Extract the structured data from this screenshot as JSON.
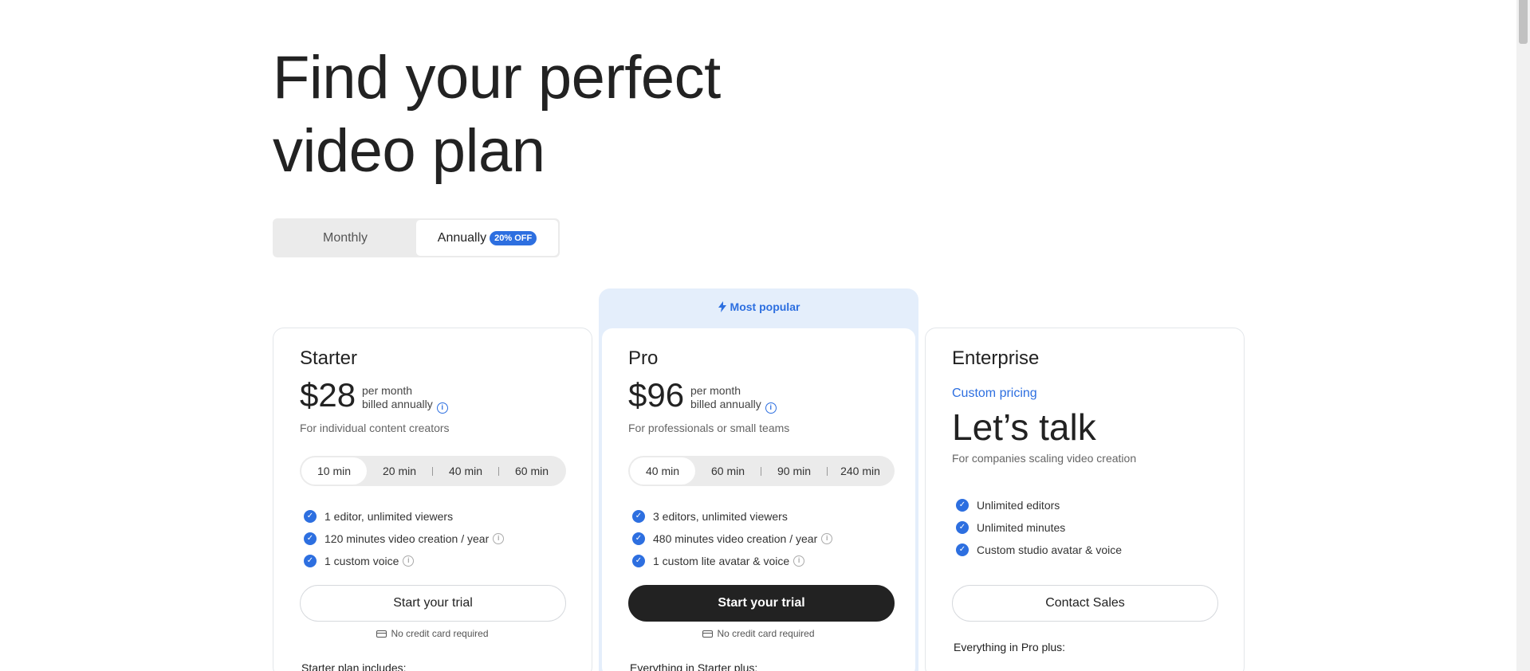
{
  "headline": {
    "line1": "Find your perfect",
    "line2": "video plan"
  },
  "billing": {
    "monthly": "Monthly",
    "annually": "Annually",
    "badge": "20% OFF",
    "selected": "annually"
  },
  "popular": {
    "label": "Most popular",
    "icon": "lightning-icon"
  },
  "colors": {
    "accent": "#2d6fe0",
    "dark_button": "#222222",
    "popular_bg": "#e4eefb"
  },
  "plans": {
    "starter": {
      "name": "Starter",
      "price": "$28",
      "per": "per month",
      "billed": "billed annually",
      "description": "For individual content creators",
      "minutes": [
        "10 min",
        "20 min",
        "40 min",
        "60 min"
      ],
      "selected_minutes": "10 min",
      "features": [
        "1 editor, unlimited viewers",
        "120 minutes video creation / year",
        "1 custom voice"
      ],
      "cta": "Start your trial",
      "no_card": "No credit card required",
      "includes": "Starter plan includes:"
    },
    "pro": {
      "name": "Pro",
      "price": "$96",
      "per": "per month",
      "billed": "billed annually",
      "description": "For professionals or small teams",
      "minutes": [
        "40 min",
        "60 min",
        "90 min",
        "240 min"
      ],
      "selected_minutes": "40 min",
      "features": [
        "3 editors, unlimited viewers",
        "480 minutes video creation / year",
        "1 custom lite avatar & voice"
      ],
      "cta": "Start your trial",
      "no_card": "No credit card required",
      "includes": "Everything in Starter plus:"
    },
    "enterprise": {
      "name": "Enterprise",
      "custom_pricing": "Custom pricing",
      "headline": "Let’s talk",
      "description": "For companies scaling video creation",
      "features": [
        "Unlimited editors",
        "Unlimited minutes",
        "Custom studio avatar & voice"
      ],
      "cta": "Contact Sales",
      "includes": "Everything in Pro plus:"
    }
  }
}
